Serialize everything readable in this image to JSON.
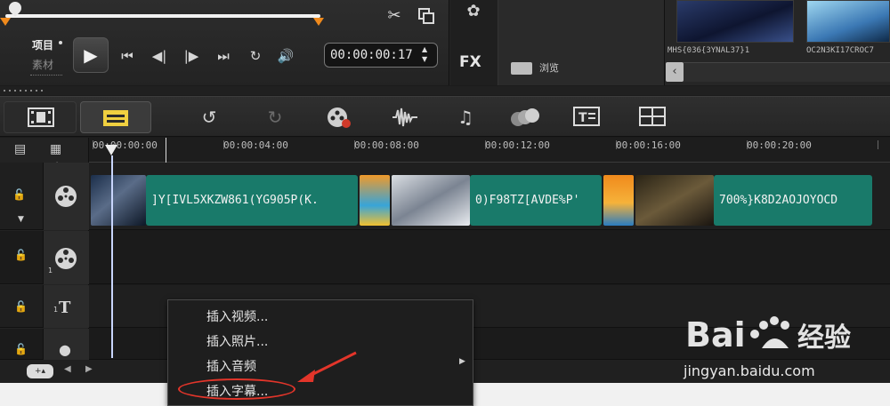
{
  "player": {
    "mode_project": "项目",
    "mode_clip": "素材",
    "timecode": "00:00:00:17",
    "icons": [
      "scissors-icon",
      "copy-frame-icon",
      "play-icon",
      "skip-start-icon",
      "prev-frame-icon",
      "next-frame-icon",
      "skip-end-icon",
      "repeat-icon",
      "volume-icon"
    ]
  },
  "library": {
    "fx_label": "FX",
    "browse_label": "浏览",
    "thumbs": [
      {
        "name": "MHS{036{3YNAL37}1"
      },
      {
        "name": "OC2N3KI17CROC7"
      }
    ]
  },
  "toolbar": {
    "tools": [
      "timeline-view-icon",
      "storyboard-view-icon",
      "undo-icon",
      "redo-icon",
      "record-capture-icon",
      "sound-mixer-icon",
      "auto-music-icon",
      "motion-track-icon",
      "subtitle-editor-icon",
      "multi-cam-icon"
    ]
  },
  "timeline": {
    "ruler": [
      "00:00:00:00",
      "00:00:04:00",
      "00:00:08:00",
      "00:00:12:00",
      "00:00:16:00",
      "00:00:20:00"
    ],
    "add_remove_label": "+/−",
    "track_number_overlay": "1",
    "track_number_title": "1",
    "clips": [
      {
        "title": "]Y[IVL5XKZW861(YG905P(K.",
        "color": "#197a6a"
      },
      {
        "title": "0)F98TZ[AVDE%P'",
        "color": "#197a6a"
      },
      {
        "title": "700%}K8D2AOJOYOCD",
        "color": "#197a6a"
      }
    ]
  },
  "context_menu": {
    "items": [
      {
        "label": "插入视频...",
        "has_submenu": false
      },
      {
        "label": "插入照片...",
        "has_submenu": false
      },
      {
        "label": "插入音频",
        "has_submenu": true
      },
      {
        "label": "插入字幕...",
        "has_submenu": false
      }
    ]
  },
  "watermark": {
    "logo": "Bai du 经验",
    "url": "jingyan.baidu.com"
  },
  "colors": {
    "accent_orange": "#f08a1c",
    "clip_teal": "#197a6a",
    "annotation_red": "#e3352a"
  }
}
